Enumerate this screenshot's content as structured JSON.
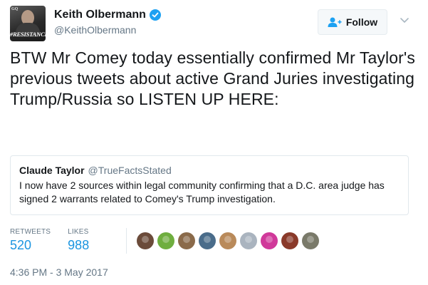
{
  "author": {
    "display_name": "Keith Olbermann",
    "handle": "@KeithOlbermann",
    "verified": true,
    "avatar_banner": "#RESISTANCE",
    "avatar_brand": "GQ"
  },
  "follow_button": {
    "label": "Follow",
    "icon": "add-person-icon"
  },
  "tweet": {
    "text": "BTW Mr Comey today essentially confirmed Mr Taylor's previous tweets about active Grand Juries investigating Trump/Russia so LISTEN UP HERE:"
  },
  "quoted_tweet": {
    "display_name": "Claude Taylor",
    "handle": "@TrueFactsStated",
    "text": "I now have 2 sources within legal community confirming that a D.C. area judge has signed 2 warrants related to Comey's Trump investigation."
  },
  "stats": {
    "retweets_label": "RETWEETS",
    "retweets_count": "520",
    "likes_label": "LIKES",
    "likes_count": "988"
  },
  "likers": [
    {
      "color": "#6b4b3a"
    },
    {
      "color": "#6fae3f"
    },
    {
      "color": "#8a6a4a"
    },
    {
      "color": "#4a6c8a"
    },
    {
      "color": "#b98a5a"
    },
    {
      "color": "#aab4bf"
    },
    {
      "color": "#d0399a"
    },
    {
      "color": "#8a3a2a"
    },
    {
      "color": "#7a7a6a"
    }
  ],
  "timestamp": "4:36 PM - 3 May 2017",
  "colors": {
    "link_blue": "#1b95e0",
    "verified_blue": "#1da1f2",
    "secondary_text": "#657786",
    "border": "#e1e8ed"
  }
}
